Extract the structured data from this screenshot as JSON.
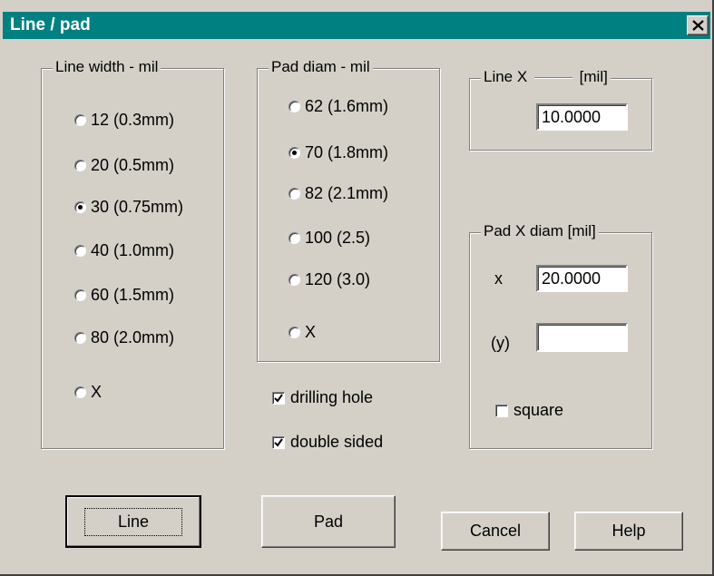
{
  "window": {
    "title": "Line / pad",
    "close_icon": "close-icon"
  },
  "line_width_group": {
    "legend": "Line width - mil",
    "options": [
      {
        "label": "12  (0.3mm)",
        "checked": false
      },
      {
        "label": "20  (0.5mm)",
        "checked": false
      },
      {
        "label": "30  (0.75mm)",
        "checked": true
      },
      {
        "label": "40  (1.0mm)",
        "checked": false
      },
      {
        "label": "60  (1.5mm)",
        "checked": false
      },
      {
        "label": "80  (2.0mm)",
        "checked": false
      },
      {
        "label": "X",
        "checked": false
      }
    ]
  },
  "pad_diam_group": {
    "legend": "Pad diam - mil",
    "options": [
      {
        "label": "62  (1.6mm)",
        "checked": false
      },
      {
        "label": "70  (1.8mm)",
        "checked": true
      },
      {
        "label": "82  (2.1mm)",
        "checked": false
      },
      {
        "label": "100  (2.5)",
        "checked": false
      },
      {
        "label": "120  (3.0)",
        "checked": false
      },
      {
        "label": "X",
        "checked": false
      }
    ]
  },
  "checkboxes": {
    "drilling_hole": {
      "label": "drilling hole",
      "checked": true
    },
    "double_sided": {
      "label": "double sided",
      "checked": true
    }
  },
  "line_x_group": {
    "legend": "Line X",
    "unit": "[mil]",
    "value": "10.0000"
  },
  "pad_x_group": {
    "legend": "Pad X diam  [mil]",
    "x_label": "x",
    "x_value": "20.0000",
    "y_label": "(y)",
    "y_value": "",
    "square": {
      "label": "square",
      "checked": false
    }
  },
  "buttons": {
    "line": "Line",
    "pad": "Pad",
    "cancel": "Cancel",
    "help": "Help"
  },
  "colors": {
    "titlebar": "#008080",
    "face": "#d4d0c8"
  }
}
